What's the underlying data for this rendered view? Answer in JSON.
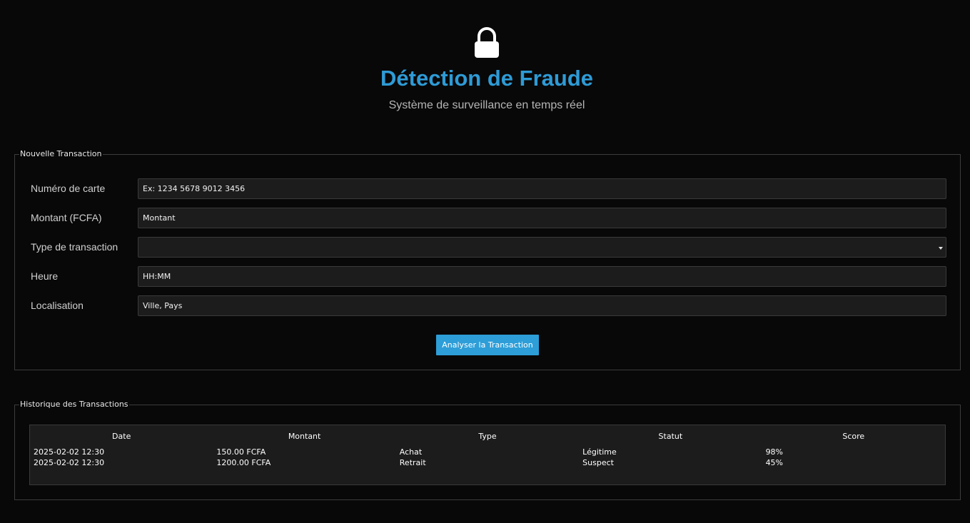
{
  "header": {
    "icon": "lock-icon",
    "title": "Détection de Fraude",
    "subtitle": "Système de surveillance en temps réel",
    "title_color": "#2e9bd6"
  },
  "form": {
    "group_title": "Nouvelle Transaction",
    "fields": {
      "card_number": {
        "label": "Numéro de carte",
        "placeholder": "Ex: 1234 5678 9012 3456",
        "value": ""
      },
      "amount": {
        "label": "Montant (FCFA)",
        "placeholder": "Montant",
        "value": ""
      },
      "transaction_type": {
        "label": "Type de transaction",
        "value": ""
      },
      "time": {
        "label": "Heure",
        "placeholder": "HH:MM",
        "value": ""
      },
      "location": {
        "label": "Localisation",
        "placeholder": "Ville, Pays",
        "value": ""
      }
    },
    "submit_label": "Analyser la Transaction",
    "accent_color": "#2d9ed8"
  },
  "history": {
    "group_title": "Historique des Transactions",
    "columns": [
      "Date",
      "Montant",
      "Type",
      "Statut",
      "Score"
    ],
    "rows": [
      {
        "date": "2025-02-02 12:30",
        "amount": "150.00 FCFA",
        "type": "Achat",
        "status": "Légitime",
        "score": "98%"
      },
      {
        "date": "2025-02-02 12:30",
        "amount": "1200.00 FCFA",
        "type": "Retrait",
        "status": "Suspect",
        "score": "45%"
      }
    ]
  }
}
